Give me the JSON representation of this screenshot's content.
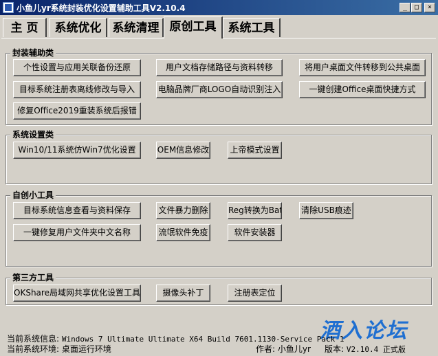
{
  "window": {
    "title": "小鱼儿yr系统封装优化设置辅助工具V2.10.4"
  },
  "tabs": [
    {
      "label": "主 页"
    },
    {
      "label": "系统优化"
    },
    {
      "label": "系统清理"
    },
    {
      "label": "原创工具"
    },
    {
      "label": "系统工具"
    }
  ],
  "groups": {
    "packaging": {
      "title": "封装辅助类",
      "buttons": [
        "个性设置与应用关联备份还原",
        "用户文档存储路径与资料转移",
        "将用户桌面文件转移到公共桌面",
        "目标系统注册表离线修改与导入",
        "电脑品牌厂商LOGO自动识别注入",
        "一键创建Office桌面快捷方式",
        "修复Office2019重装系统后报错"
      ]
    },
    "system": {
      "title": "系统设置类",
      "buttons": [
        "Win10/11系统仿Win7优化设置",
        "OEM信息修改",
        "上帝模式设置"
      ]
    },
    "original": {
      "title": "自创小工具",
      "buttons": [
        "目标系统信息查看与资料保存",
        "文件暴力删除",
        "Reg转换为Bat",
        "清除USB痕迹",
        "一键修复用户文件夹中文名称",
        "流氓软件免疫",
        "软件安装器"
      ]
    },
    "thirdparty": {
      "title": "第三方工具",
      "buttons": [
        "OKShare局域网共享优化设置工具",
        "摄像头补丁",
        "注册表定位"
      ]
    }
  },
  "status": {
    "info_label": "当前系统信息:",
    "info_value": "Windows 7 Ultimate Ultimate X64 Build 7601.1130-Service Pack 1",
    "env_label": "当前系统环境:",
    "env_value": "桌面运行环境",
    "author_label": "作者:",
    "author_value": "小鱼儿yr",
    "version_label": "版本:",
    "version_value": "V2.10.4 正式版"
  },
  "watermark": "酒入论坛"
}
